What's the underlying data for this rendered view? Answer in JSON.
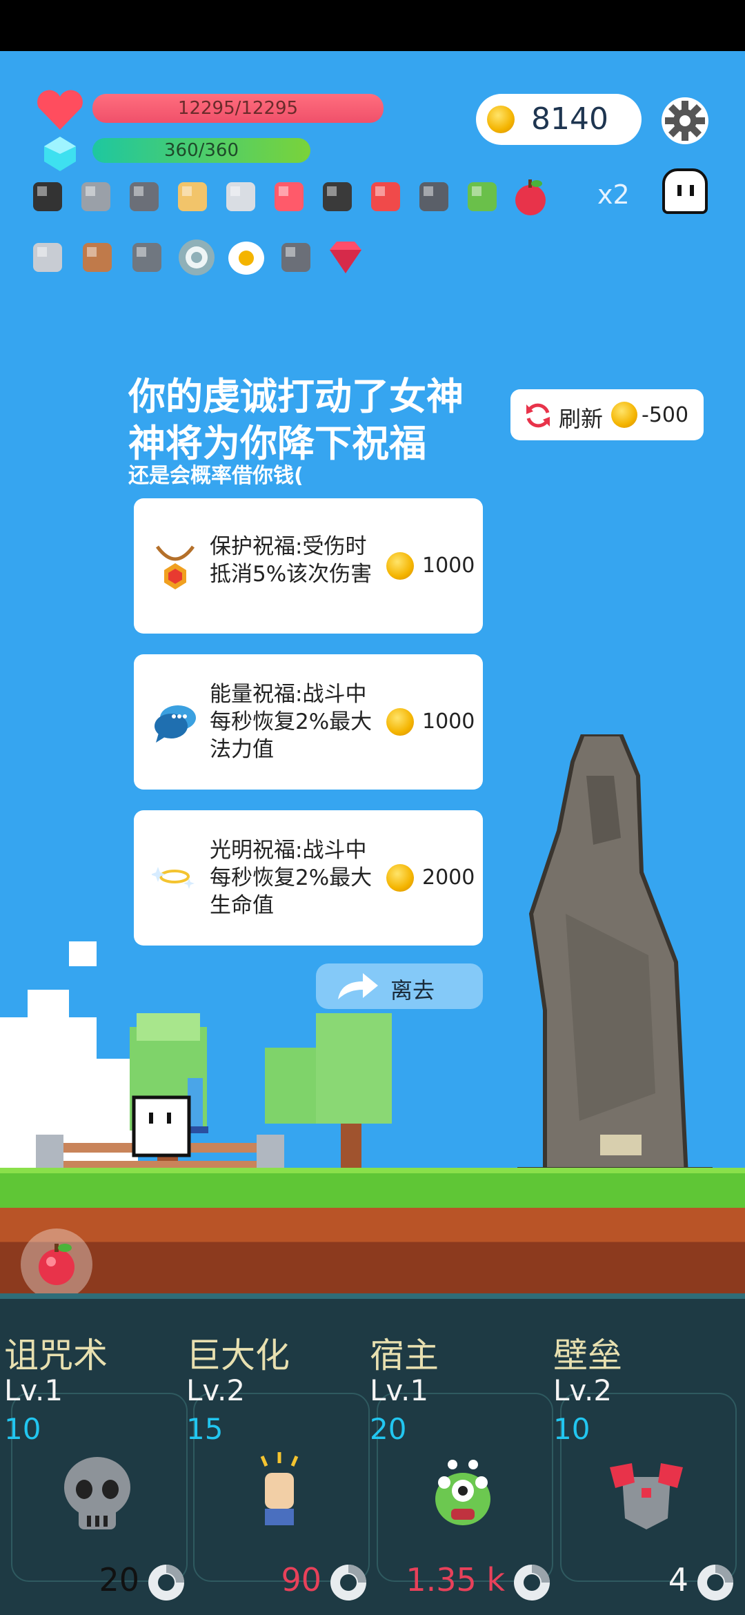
{
  "hud": {
    "hp_text": "12295/12295",
    "mp_text": "360/360",
    "coins": "8140",
    "multiplier": "x2",
    "hp_fraction": 1.0,
    "mp_fraction": 1.0
  },
  "inventory": {
    "row1": [
      "bat-icon",
      "hammer-icon",
      "mortar-icon",
      "scroll-icon",
      "sword-icon",
      "pill-icon",
      "cauldron-icon",
      "sneaker-icon",
      "uzi-icon",
      "sapling-icon",
      "apple-icon"
    ],
    "row2": [
      "short-sword-icon",
      "drumstick-icon",
      "helmet-icon",
      "shield-icon",
      "fried-egg-icon",
      "mortar-icon",
      "ruby-icon"
    ]
  },
  "event": {
    "title_line1": "你的虔诚打动了女神",
    "title_line2": "神将为你降下祝福",
    "subtitle": "还是会概率借你钱(",
    "refresh_label": "刷新",
    "refresh_cost": "-500",
    "leave_label": "离去",
    "blessings": [
      {
        "icon": "amulet-icon",
        "lines": [
          "保护祝福:受伤时",
          "抵消5%该次伤害"
        ],
        "price": "1000"
      },
      {
        "icon": "chat-bubble-icon",
        "lines": [
          "能量祝福:战斗中",
          "每秒恢复2%最大",
          "法力值"
        ],
        "price": "1000"
      },
      {
        "icon": "halo-icon",
        "lines": [
          "光明祝福:战斗中",
          "每秒恢复2%最大",
          "生命值"
        ],
        "price": "2000"
      }
    ]
  },
  "skills": [
    {
      "name": "诅咒术",
      "level": "Lv.1",
      "cost": "10",
      "count": "20",
      "icon": "skull-icon",
      "count_color": "#111111"
    },
    {
      "name": "巨大化",
      "level": "Lv.2",
      "cost": "15",
      "count": "90",
      "icon": "fist-icon",
      "count_color": "#e8415a"
    },
    {
      "name": "宿主",
      "level": "Lv.1",
      "cost": "20",
      "count": "1.35 k",
      "icon": "monster-icon",
      "count_color": "#e8415a"
    },
    {
      "name": "壁垒",
      "level": "Lv.2",
      "cost": "10",
      "count": "4",
      "icon": "armor-icon",
      "count_color": "#f4f4f4"
    }
  ]
}
